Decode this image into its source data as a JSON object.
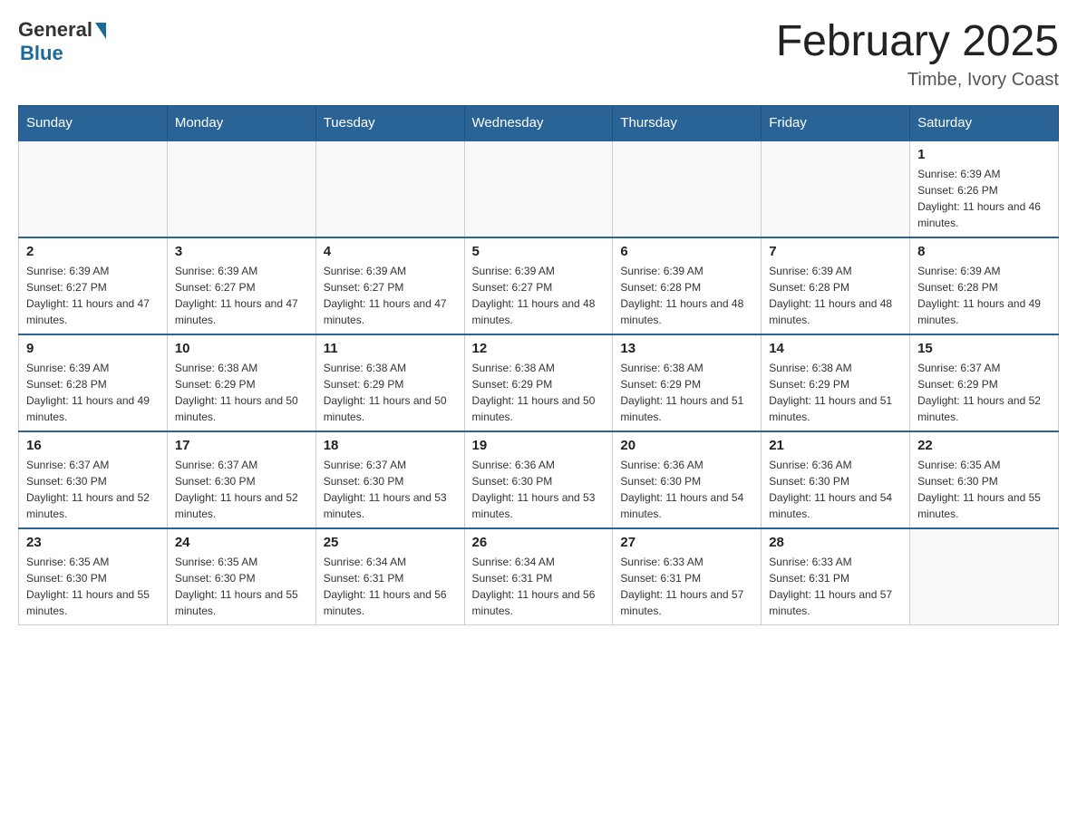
{
  "header": {
    "logo_general": "General",
    "logo_blue": "Blue",
    "month_title": "February 2025",
    "subtitle": "Timbe, Ivory Coast"
  },
  "days_of_week": [
    "Sunday",
    "Monday",
    "Tuesday",
    "Wednesday",
    "Thursday",
    "Friday",
    "Saturday"
  ],
  "weeks": [
    {
      "days": [
        {
          "num": "",
          "info": ""
        },
        {
          "num": "",
          "info": ""
        },
        {
          "num": "",
          "info": ""
        },
        {
          "num": "",
          "info": ""
        },
        {
          "num": "",
          "info": ""
        },
        {
          "num": "",
          "info": ""
        },
        {
          "num": "1",
          "info": "Sunrise: 6:39 AM\nSunset: 6:26 PM\nDaylight: 11 hours and 46 minutes."
        }
      ]
    },
    {
      "days": [
        {
          "num": "2",
          "info": "Sunrise: 6:39 AM\nSunset: 6:27 PM\nDaylight: 11 hours and 47 minutes."
        },
        {
          "num": "3",
          "info": "Sunrise: 6:39 AM\nSunset: 6:27 PM\nDaylight: 11 hours and 47 minutes."
        },
        {
          "num": "4",
          "info": "Sunrise: 6:39 AM\nSunset: 6:27 PM\nDaylight: 11 hours and 47 minutes."
        },
        {
          "num": "5",
          "info": "Sunrise: 6:39 AM\nSunset: 6:27 PM\nDaylight: 11 hours and 48 minutes."
        },
        {
          "num": "6",
          "info": "Sunrise: 6:39 AM\nSunset: 6:28 PM\nDaylight: 11 hours and 48 minutes."
        },
        {
          "num": "7",
          "info": "Sunrise: 6:39 AM\nSunset: 6:28 PM\nDaylight: 11 hours and 48 minutes."
        },
        {
          "num": "8",
          "info": "Sunrise: 6:39 AM\nSunset: 6:28 PM\nDaylight: 11 hours and 49 minutes."
        }
      ]
    },
    {
      "days": [
        {
          "num": "9",
          "info": "Sunrise: 6:39 AM\nSunset: 6:28 PM\nDaylight: 11 hours and 49 minutes."
        },
        {
          "num": "10",
          "info": "Sunrise: 6:38 AM\nSunset: 6:29 PM\nDaylight: 11 hours and 50 minutes."
        },
        {
          "num": "11",
          "info": "Sunrise: 6:38 AM\nSunset: 6:29 PM\nDaylight: 11 hours and 50 minutes."
        },
        {
          "num": "12",
          "info": "Sunrise: 6:38 AM\nSunset: 6:29 PM\nDaylight: 11 hours and 50 minutes."
        },
        {
          "num": "13",
          "info": "Sunrise: 6:38 AM\nSunset: 6:29 PM\nDaylight: 11 hours and 51 minutes."
        },
        {
          "num": "14",
          "info": "Sunrise: 6:38 AM\nSunset: 6:29 PM\nDaylight: 11 hours and 51 minutes."
        },
        {
          "num": "15",
          "info": "Sunrise: 6:37 AM\nSunset: 6:29 PM\nDaylight: 11 hours and 52 minutes."
        }
      ]
    },
    {
      "days": [
        {
          "num": "16",
          "info": "Sunrise: 6:37 AM\nSunset: 6:30 PM\nDaylight: 11 hours and 52 minutes."
        },
        {
          "num": "17",
          "info": "Sunrise: 6:37 AM\nSunset: 6:30 PM\nDaylight: 11 hours and 52 minutes."
        },
        {
          "num": "18",
          "info": "Sunrise: 6:37 AM\nSunset: 6:30 PM\nDaylight: 11 hours and 53 minutes."
        },
        {
          "num": "19",
          "info": "Sunrise: 6:36 AM\nSunset: 6:30 PM\nDaylight: 11 hours and 53 minutes."
        },
        {
          "num": "20",
          "info": "Sunrise: 6:36 AM\nSunset: 6:30 PM\nDaylight: 11 hours and 54 minutes."
        },
        {
          "num": "21",
          "info": "Sunrise: 6:36 AM\nSunset: 6:30 PM\nDaylight: 11 hours and 54 minutes."
        },
        {
          "num": "22",
          "info": "Sunrise: 6:35 AM\nSunset: 6:30 PM\nDaylight: 11 hours and 55 minutes."
        }
      ]
    },
    {
      "days": [
        {
          "num": "23",
          "info": "Sunrise: 6:35 AM\nSunset: 6:30 PM\nDaylight: 11 hours and 55 minutes."
        },
        {
          "num": "24",
          "info": "Sunrise: 6:35 AM\nSunset: 6:30 PM\nDaylight: 11 hours and 55 minutes."
        },
        {
          "num": "25",
          "info": "Sunrise: 6:34 AM\nSunset: 6:31 PM\nDaylight: 11 hours and 56 minutes."
        },
        {
          "num": "26",
          "info": "Sunrise: 6:34 AM\nSunset: 6:31 PM\nDaylight: 11 hours and 56 minutes."
        },
        {
          "num": "27",
          "info": "Sunrise: 6:33 AM\nSunset: 6:31 PM\nDaylight: 11 hours and 57 minutes."
        },
        {
          "num": "28",
          "info": "Sunrise: 6:33 AM\nSunset: 6:31 PM\nDaylight: 11 hours and 57 minutes."
        },
        {
          "num": "",
          "info": ""
        }
      ]
    }
  ]
}
